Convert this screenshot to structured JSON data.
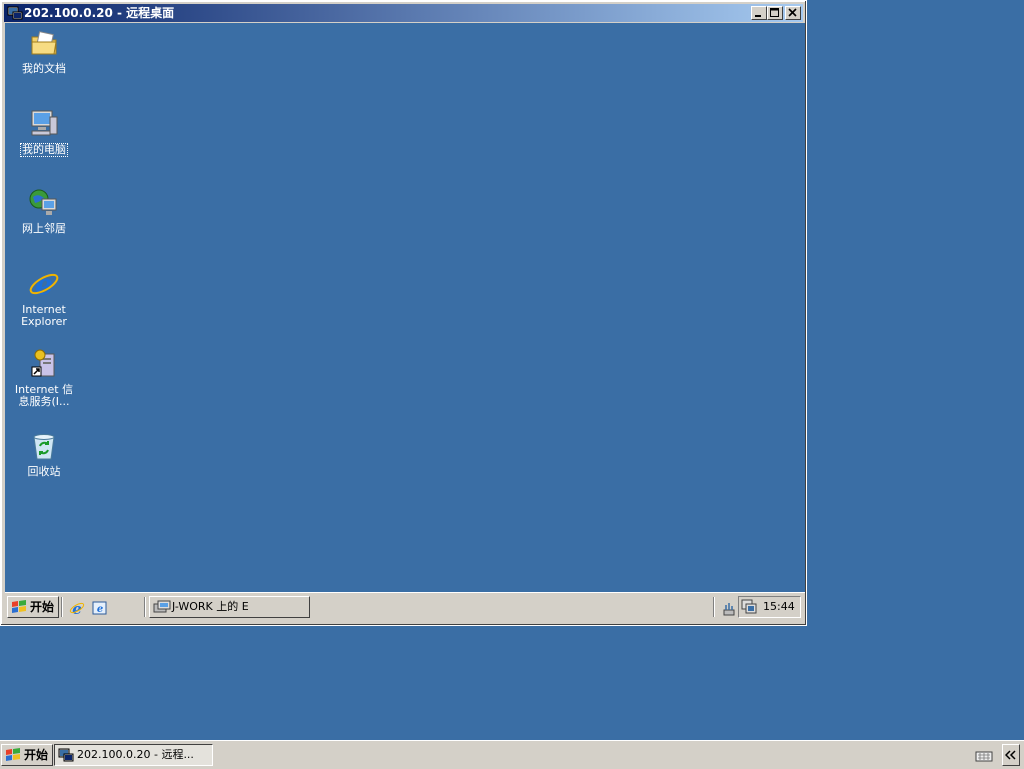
{
  "window": {
    "title": "202.100.0.20 - 远程桌面"
  },
  "desktop": {
    "icons": [
      {
        "label": "我的文档",
        "icon": "my-documents-folder-icon"
      },
      {
        "label": "我的电脑",
        "icon": "my-computer-icon"
      },
      {
        "label": "网上邻居",
        "icon": "network-places-icon"
      },
      {
        "label_line1": "Internet",
        "label_line2": "Explorer",
        "icon": "internet-explorer-icon"
      },
      {
        "label_line1": "Internet 信",
        "label_line2": "息服务(I...",
        "icon": "iis-shortcut-icon"
      },
      {
        "label": "回收站",
        "icon": "recycle-bin-icon"
      }
    ]
  },
  "remote_taskbar": {
    "start_label": "开始",
    "task_button_label": "J-WORK 上的 E",
    "clock": "15:44"
  },
  "host_taskbar": {
    "start_label": "开始",
    "task_button_label": "202.100.0.20 - 远程..."
  },
  "colors": {
    "desktop": "#3a6ea5",
    "title_start": "#0a246a",
    "title_end": "#a6caf0",
    "face": "#d4d0c8"
  }
}
